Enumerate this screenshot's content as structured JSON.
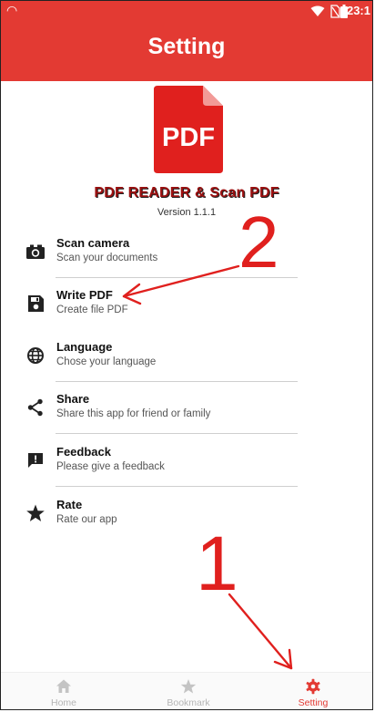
{
  "status_bar": {
    "time": "23:1"
  },
  "app_bar": {
    "title": "Setting"
  },
  "logo": {
    "text": "PDF"
  },
  "app_name": "PDF READER & Scan PDF",
  "version": "Version 1.1.1",
  "menu": [
    {
      "title": "Scan camera",
      "subtitle": "Scan your documents",
      "icon": "camera-icon"
    },
    {
      "title": "Write PDF",
      "subtitle": "Create file PDF",
      "icon": "save-icon"
    },
    {
      "title": "Language",
      "subtitle": "Chose your language",
      "icon": "globe-icon"
    },
    {
      "title": "Share",
      "subtitle": "Share this app for friend or family",
      "icon": "share-icon"
    },
    {
      "title": "Feedback",
      "subtitle": "Please give a feedback",
      "icon": "feedback-icon"
    },
    {
      "title": "Rate",
      "subtitle": "Rate our app",
      "icon": "star-icon"
    }
  ],
  "bottom_nav": [
    {
      "label": "Home",
      "icon": "home-icon",
      "active": false
    },
    {
      "label": "Bookmark",
      "icon": "star-icon",
      "active": false
    },
    {
      "label": "Setting",
      "icon": "gear-icon",
      "active": true
    }
  ],
  "annotations": {
    "step1": "1",
    "step2": "2"
  },
  "colors": {
    "accent": "#e33a33",
    "annotation": "#e0201e"
  }
}
